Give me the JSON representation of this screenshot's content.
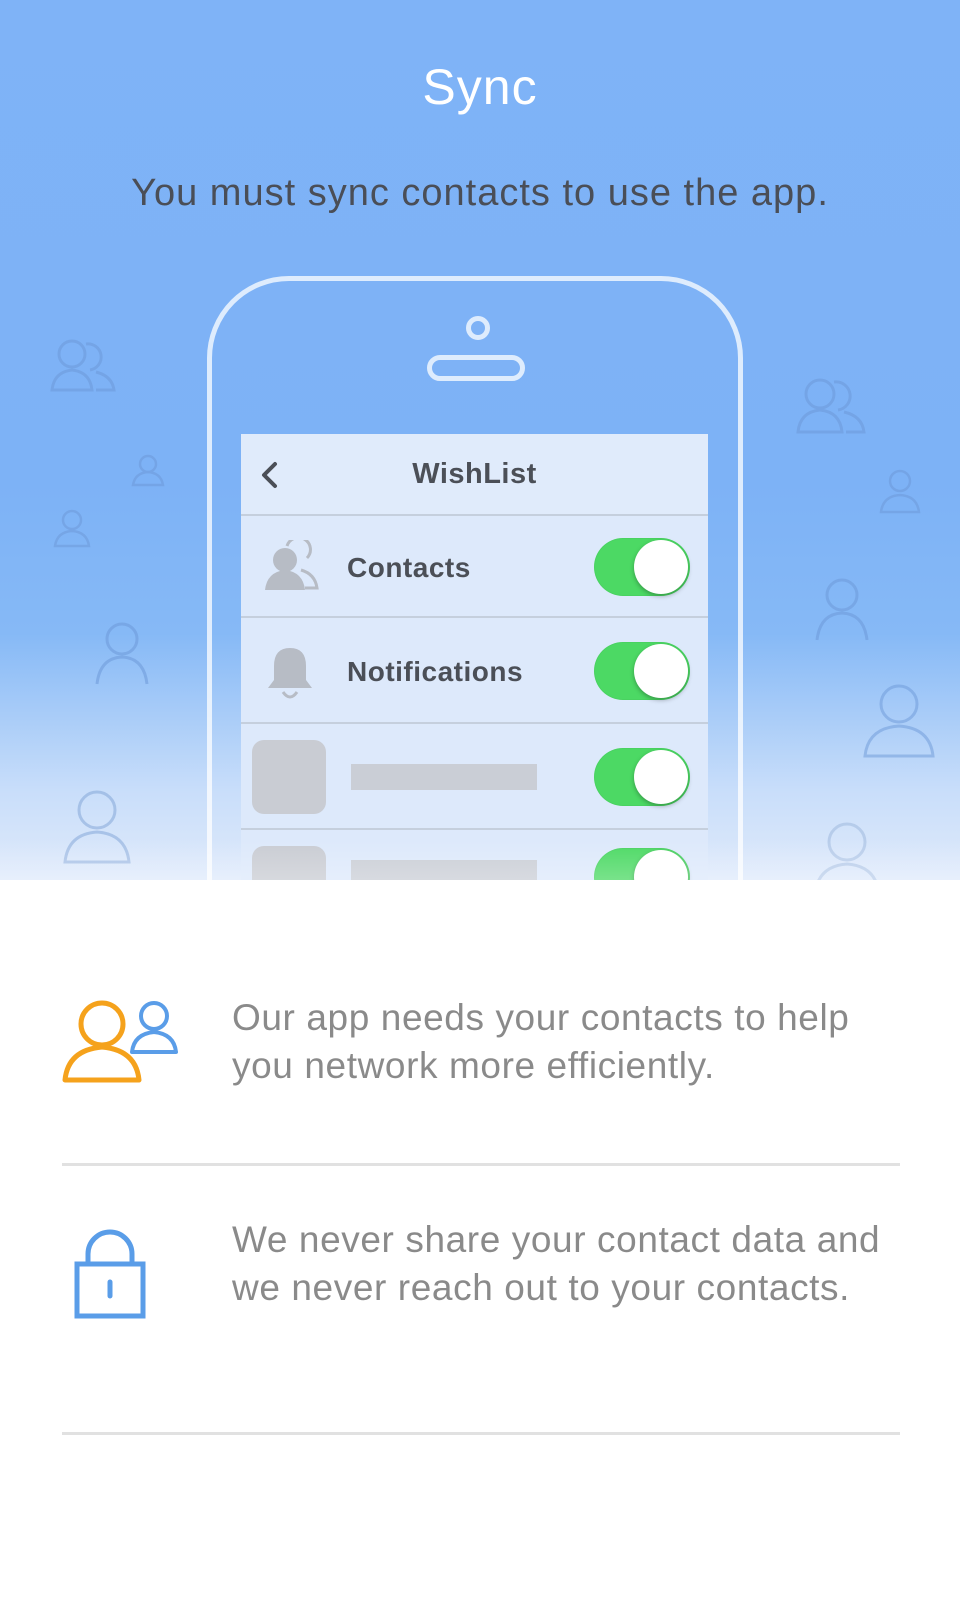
{
  "header": {
    "title": "Sync",
    "subtitle": "You must sync contacts to use the app."
  },
  "phone_preview": {
    "nav_title": "WishList",
    "back_icon": "chevron-left-icon",
    "rows": [
      {
        "label": "Contacts",
        "icon": "contacts-icon",
        "toggle_on": true
      },
      {
        "label": "Notifications",
        "icon": "bell-icon",
        "toggle_on": true
      },
      {
        "label": "",
        "icon": "placeholder",
        "toggle_on": true
      },
      {
        "label": "",
        "icon": "placeholder",
        "toggle_on": true
      }
    ],
    "toggle_color": "#4cd964"
  },
  "info_items": [
    {
      "icon": "users-icon",
      "text": "Our app needs your contacts to help you network more efficiently."
    },
    {
      "icon": "lock-icon",
      "text": "We never share your contact data and we never reach out to your contacts."
    }
  ],
  "colors": {
    "hero_blue": "#7fb3f7",
    "accent_orange": "#f5a21c",
    "accent_blue": "#5a9de8",
    "text_gray": "#8a8a8a"
  }
}
